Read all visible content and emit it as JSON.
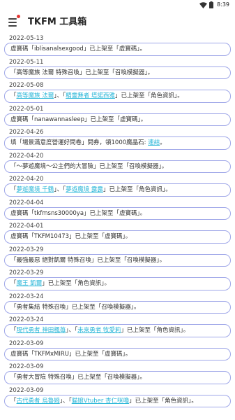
{
  "status_bar": {
    "time": "8:39"
  },
  "app_bar": {
    "title": "TKFM 工具箱"
  },
  "entries": [
    {
      "date": "2022-05-13",
      "parts": [
        {
          "t": "虛寶碼「iblisanalsexgood」已上架至「虛寶碼」。"
        }
      ]
    },
    {
      "date": "2022-05-11",
      "parts": [
        {
          "t": "「高等魔族 法爾 特殊召喚」已上架至「召喚模擬器」。"
        }
      ]
    },
    {
      "date": "2022-05-08",
      "parts": [
        {
          "t": "「"
        },
        {
          "t": "高等魔族 法爾",
          "link": true
        },
        {
          "t": "」、「"
        },
        {
          "t": "精靈舞者 塔諾西雅",
          "link": true
        },
        {
          "t": "」已上架至「角色資訊」。"
        }
      ]
    },
    {
      "date": "2022-05-01",
      "parts": [
        {
          "t": "虛寶碼「nanawannasleep」已上架至「虛寶碼」。"
        }
      ]
    },
    {
      "date": "2022-04-26",
      "parts": [
        {
          "t": "填「場景滿意度營運好問卷」問券，領1000魔晶石: "
        },
        {
          "t": "連結",
          "link": true
        },
        {
          "t": "。"
        }
      ]
    },
    {
      "date": "2022-04-20",
      "parts": [
        {
          "t": "「〜夢遊魔境〜公主們的大冒險」已上架至「召喚模擬器」。"
        }
      ]
    },
    {
      "date": "2022-04-20",
      "parts": [
        {
          "t": "「"
        },
        {
          "t": "夢遊魔境 千鶴",
          "link": true
        },
        {
          "t": "」、「"
        },
        {
          "t": "夢遊魔境 露露",
          "link": true
        },
        {
          "t": "」已上架至「角色資訊」。"
        }
      ]
    },
    {
      "date": "2022-04-04",
      "parts": [
        {
          "t": "虛寶碼「tkfmsns30000ya」已上架至「虛寶碼」。"
        }
      ]
    },
    {
      "date": "2022-04-01",
      "parts": [
        {
          "t": "虛寶碼「TKFM10473」已上架至「虛寶碼」。"
        }
      ]
    },
    {
      "date": "2022-03-29",
      "parts": [
        {
          "t": "「最強最惡 絕對凱爾 特殊召喚」已上架至「召喚模擬器」。"
        }
      ]
    },
    {
      "date": "2022-03-29",
      "parts": [
        {
          "t": "「"
        },
        {
          "t": "魔王 凱爾",
          "link": true
        },
        {
          "t": "」已上架至「角色資訊」。"
        }
      ]
    },
    {
      "date": "2022-03-24",
      "parts": [
        {
          "t": "「勇者集結 特殊召喚」已上架至「召喚模擬器」。"
        }
      ]
    },
    {
      "date": "2022-03-24",
      "parts": [
        {
          "t": "「"
        },
        {
          "t": "現代勇者 神田楓苺",
          "link": true
        },
        {
          "t": "」、「"
        },
        {
          "t": "未來勇者 牧愛莉",
          "link": true
        },
        {
          "t": "」已上架至「角色資訊」。"
        }
      ]
    },
    {
      "date": "2022-03-09",
      "parts": [
        {
          "t": "虛寶碼「TKFMxMIRU」已上架至「虛寶碼」。"
        }
      ]
    },
    {
      "date": "2022-03-09",
      "parts": [
        {
          "t": "「勇者大冒險 特殊召喚」已上架至「召喚模擬器」。"
        }
      ]
    },
    {
      "date": "2022-03-09",
      "parts": [
        {
          "t": "「"
        },
        {
          "t": "古代勇者 烏魯姆",
          "link": true
        },
        {
          "t": "」、「"
        },
        {
          "t": "貓娘Vtuber 杏仁咪嚕",
          "link": true
        },
        {
          "t": "」已上架至「角色資訊」。"
        }
      ]
    }
  ]
}
